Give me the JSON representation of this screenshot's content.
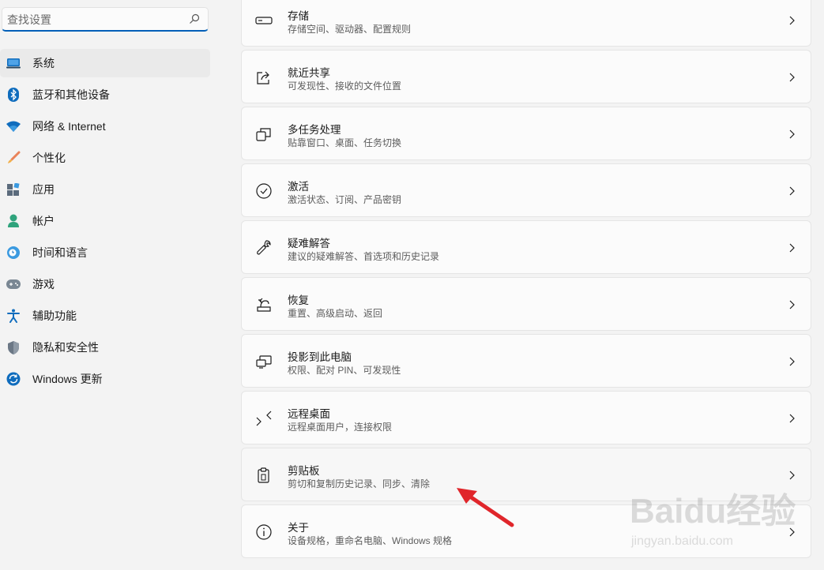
{
  "search": {
    "placeholder": "查找设置"
  },
  "sidebar": {
    "items": [
      {
        "label": "系统",
        "icon": "laptop-icon"
      },
      {
        "label": "蓝牙和其他设备",
        "icon": "bluetooth-icon"
      },
      {
        "label": "网络 & Internet",
        "icon": "wifi-icon"
      },
      {
        "label": "个性化",
        "icon": "brush-icon"
      },
      {
        "label": "应用",
        "icon": "apps-icon"
      },
      {
        "label": "帐户",
        "icon": "account-icon"
      },
      {
        "label": "时间和语言",
        "icon": "globe-clock-icon"
      },
      {
        "label": "游戏",
        "icon": "gamepad-icon"
      },
      {
        "label": "辅助功能",
        "icon": "accessibility-icon"
      },
      {
        "label": "隐私和安全性",
        "icon": "shield-icon"
      },
      {
        "label": "Windows 更新",
        "icon": "windows-update-icon"
      }
    ]
  },
  "main": {
    "items": [
      {
        "title": "存储",
        "subtitle": "存储空间、驱动器、配置规则",
        "icon": "storage-drive-icon"
      },
      {
        "title": "就近共享",
        "subtitle": "可发现性、接收的文件位置",
        "icon": "share-icon"
      },
      {
        "title": "多任务处理",
        "subtitle": "贴靠窗口、桌面、任务切换",
        "icon": "multitask-icon"
      },
      {
        "title": "激活",
        "subtitle": "激活状态、订阅、产品密钥",
        "icon": "check-circle-icon"
      },
      {
        "title": "疑难解答",
        "subtitle": "建议的疑难解答、首选项和历史记录",
        "icon": "wrench-icon"
      },
      {
        "title": "恢复",
        "subtitle": "重置、高级启动、返回",
        "icon": "recovery-icon"
      },
      {
        "title": "投影到此电脑",
        "subtitle": "权限、配对 PIN、可发现性",
        "icon": "project-icon"
      },
      {
        "title": "远程桌面",
        "subtitle": "远程桌面用户，连接权限",
        "icon": "remote-desktop-icon"
      },
      {
        "title": "剪贴板",
        "subtitle": "剪切和复制历史记录、同步、清除",
        "icon": "clipboard-icon"
      },
      {
        "title": "关于",
        "subtitle": "设备规格，重命名电脑、Windows 规格",
        "icon": "info-icon"
      }
    ]
  },
  "colors": {
    "accent": "#005fb8",
    "annotation_arrow": "#e0262b"
  },
  "watermark": {
    "brand": "Baidu经验",
    "url": "jingyan.baidu.com"
  }
}
